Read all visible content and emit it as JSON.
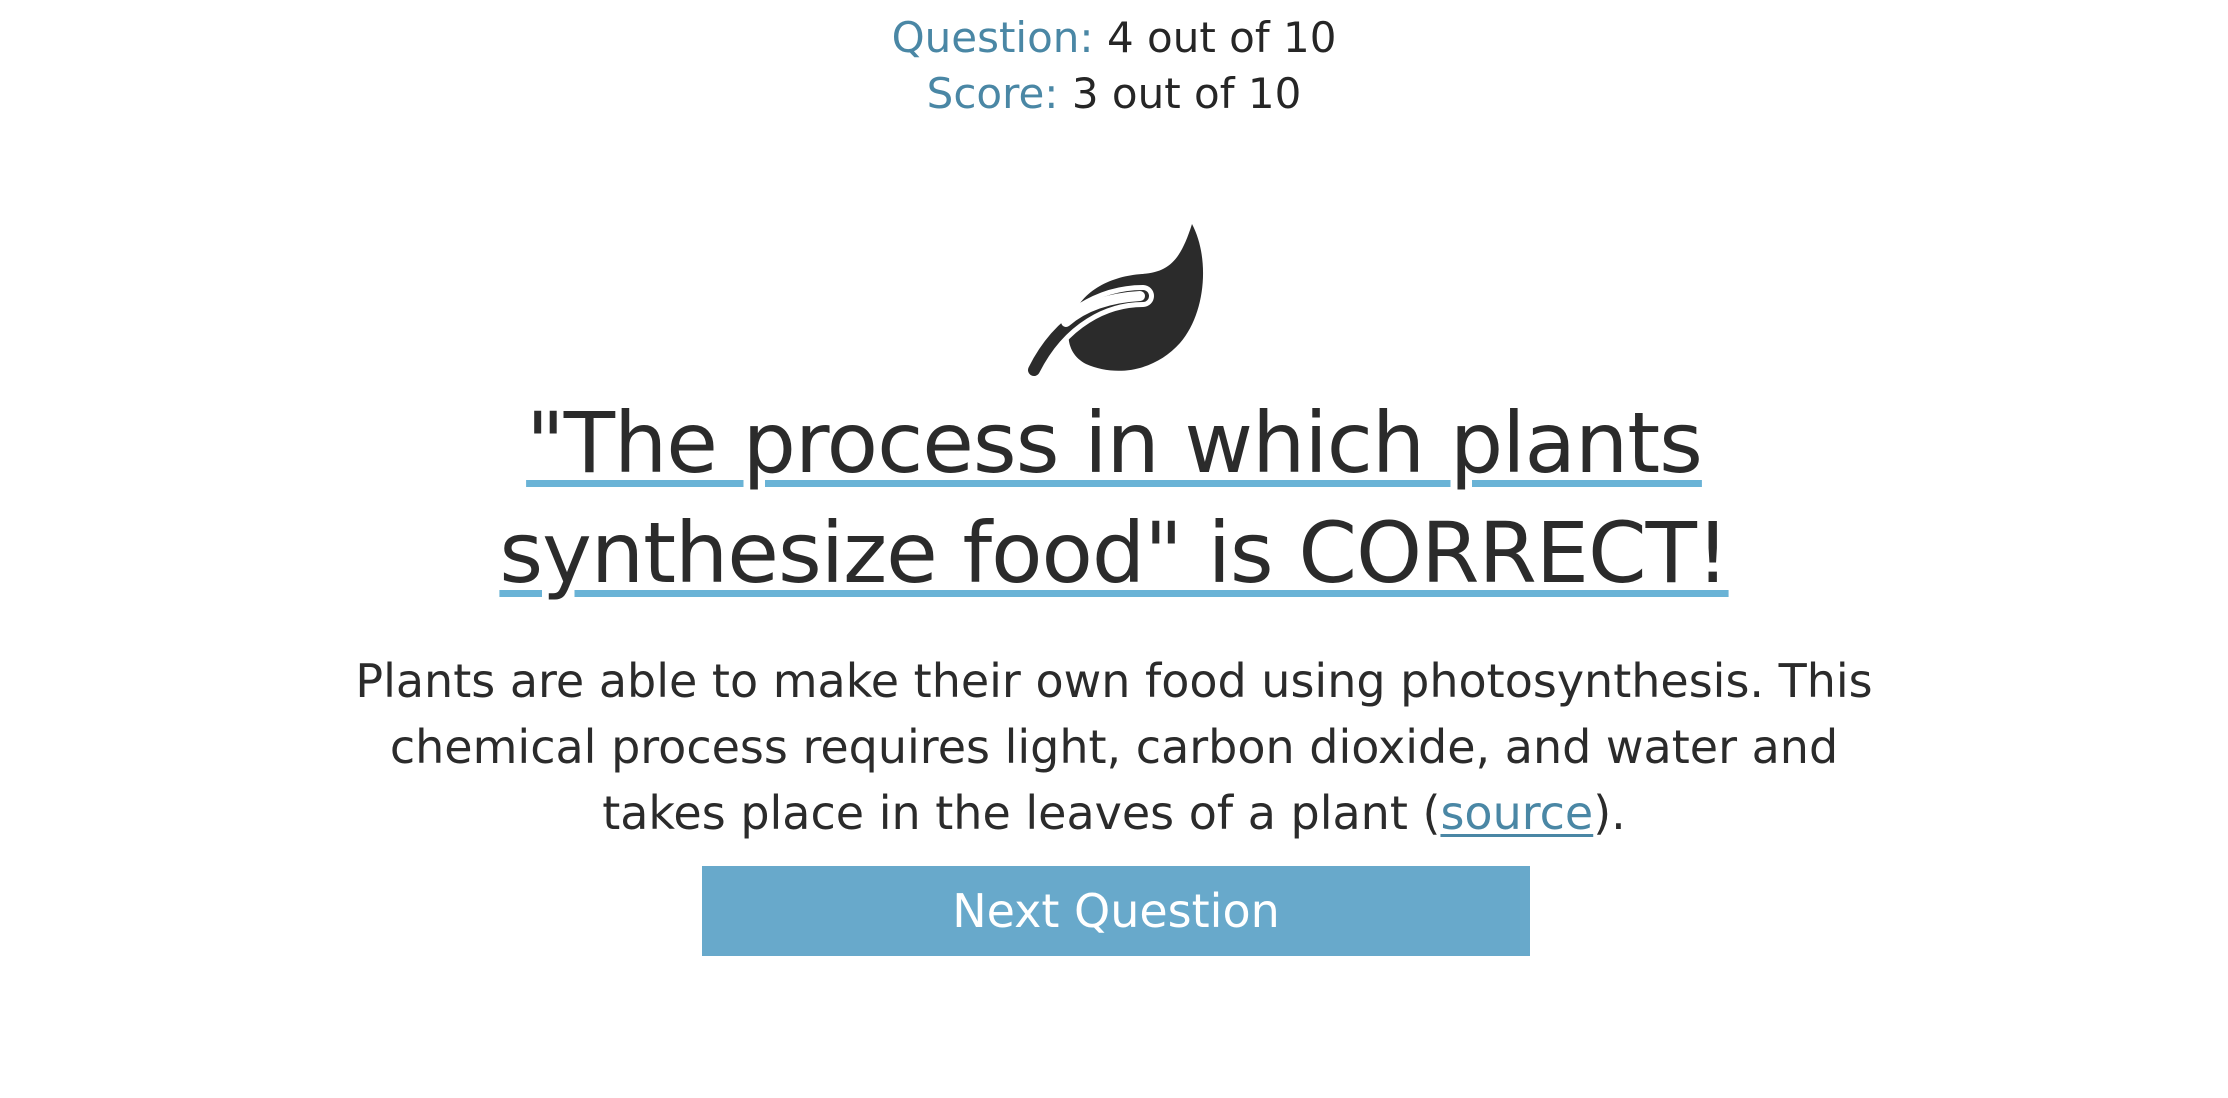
{
  "progress": {
    "question_label": "Question:",
    "question_value": "4 out of 10",
    "score_label": "Score:",
    "score_value": "3 out of 10"
  },
  "result": {
    "icon": "leaf-icon",
    "headline": "\"The process in which plants synthesize food\" is CORRECT!",
    "explanation_text": "Plants are able to make their own food using photosynthesis. This chemical process requires light, carbon dioxide, and water and takes place in the leaves of a plant (",
    "source_link_label": "source",
    "explanation_end": ")."
  },
  "actions": {
    "next_label": "Next Question"
  },
  "colors": {
    "accent": "#68a9cb",
    "label": "#4a87a5",
    "underline": "#6ab3d6",
    "text": "#2b2b2b"
  }
}
